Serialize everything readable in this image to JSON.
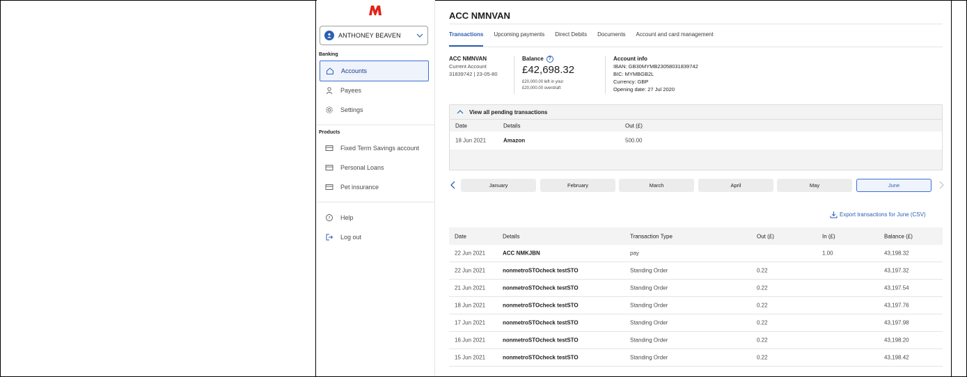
{
  "brand": {
    "logo_letter": "M",
    "accent": "#2b5fb4",
    "logo_color": "#e2231a"
  },
  "sidebar": {
    "user_name": "ANTHONEY BEAVEN",
    "banking_label": "Banking",
    "banking_items": [
      {
        "label": "Accounts",
        "icon": "home-icon",
        "active": true
      },
      {
        "label": "Payees",
        "icon": "person-icon"
      },
      {
        "label": "Settings",
        "icon": "gear-icon"
      }
    ],
    "products_label": "Products",
    "product_items": [
      {
        "label": "Fixed Term Savings account",
        "icon": "card-icon"
      },
      {
        "label": "Personal Loans",
        "icon": "card-icon"
      },
      {
        "label": "Pet insurance",
        "icon": "card-icon"
      }
    ],
    "footer_items": [
      {
        "label": "Help",
        "icon": "help-icon"
      },
      {
        "label": "Log out",
        "icon": "logout-icon"
      }
    ]
  },
  "main": {
    "title": "ACC NMNVAN",
    "tabs": [
      {
        "label": "Transactions",
        "active": true
      },
      {
        "label": "Upcoming payments"
      },
      {
        "label": "Direct Debits"
      },
      {
        "label": "Documents"
      },
      {
        "label": "Account and card management"
      }
    ],
    "account": {
      "name": "ACC NMNVAN",
      "type": "Current Account",
      "number_sort": "31839742  |  23-05-80"
    },
    "balance": {
      "label": "Balance",
      "amount": "£42,698.32",
      "note_line1": "£20,000.00 left in your",
      "note_line2": "£20,000.00 overdraft"
    },
    "info": {
      "label": "Account info",
      "iban": "IBAN: GB30MYMB23058031839742",
      "bic": "BIC: MYMBGB2L",
      "currency": "Currency: GBP",
      "opening": "Opening date: 27 Jul 2020"
    },
    "pending": {
      "toggle_label": "View all pending transactions",
      "columns": {
        "date": "Date",
        "details": "Details",
        "out": "Out (£)"
      },
      "rows": [
        {
          "date": "18 Jun 2021",
          "details": "Amazon",
          "out": "500.00"
        }
      ]
    },
    "months": [
      "January",
      "February",
      "March",
      "April",
      "May",
      "June"
    ],
    "active_month": "June",
    "export_label": "Export transactions for June (CSV)",
    "transactions": {
      "columns": {
        "date": "Date",
        "details": "Details",
        "type": "Transaction Type",
        "out": "Out (£)",
        "in": "In (£)",
        "balance": "Balance (£)"
      },
      "rows": [
        {
          "date": "22 Jun 2021",
          "details": "ACC NMKJBN",
          "type": "pay",
          "out": "",
          "in": "1.00",
          "balance": "43,198.32"
        },
        {
          "date": "22 Jun 2021",
          "details": "nonmetroSTOcheck testSTO",
          "type": "Standing Order",
          "out": "0.22",
          "in": "",
          "balance": "43,197.32"
        },
        {
          "date": "21 Jun 2021",
          "details": "nonmetroSTOcheck testSTO",
          "type": "Standing Order",
          "out": "0.22",
          "in": "",
          "balance": "43,197.54"
        },
        {
          "date": "18 Jun 2021",
          "details": "nonmetroSTOcheck testSTO",
          "type": "Standing Order",
          "out": "0.22",
          "in": "",
          "balance": "43,197.76"
        },
        {
          "date": "17 Jun 2021",
          "details": "nonmetroSTOcheck testSTO",
          "type": "Standing Order",
          "out": "0.22",
          "in": "",
          "balance": "43,197.98"
        },
        {
          "date": "16 Jun 2021",
          "details": "nonmetroSTOcheck testSTO",
          "type": "Standing Order",
          "out": "0.22",
          "in": "",
          "balance": "43,198.20"
        },
        {
          "date": "15 Jun 2021",
          "details": "nonmetroSTOcheck testSTO",
          "type": "Standing Order",
          "out": "0.22",
          "in": "",
          "balance": "43,198.42"
        }
      ]
    }
  }
}
